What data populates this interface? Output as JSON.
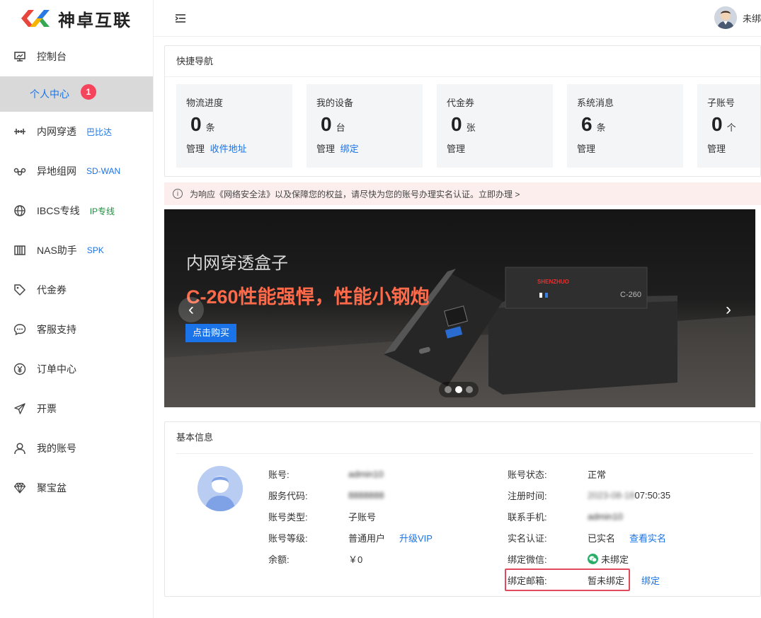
{
  "brand": {
    "name": "神卓互联"
  },
  "sidebar": {
    "items": [
      {
        "id": "console",
        "icon": "monitor-icon",
        "label": "控制台",
        "tag": ""
      },
      {
        "id": "personal",
        "icon": "",
        "label": "个人中心",
        "badge": "1"
      },
      {
        "id": "penetrate",
        "icon": "tunnel-icon",
        "label": "内网穿透",
        "tag": "巴比达"
      },
      {
        "id": "sdwan",
        "icon": "network-icon",
        "label": "异地组网",
        "tag": "SD-WAN"
      },
      {
        "id": "ibcs",
        "icon": "globe-icon",
        "label": "IBCS专线",
        "tag": "IP专线"
      },
      {
        "id": "nas",
        "icon": "nas-icon",
        "label": "NAS助手",
        "tag": "SPK"
      },
      {
        "id": "voucher",
        "icon": "tag-icon",
        "label": "代金券",
        "tag": ""
      },
      {
        "id": "support",
        "icon": "chat-icon",
        "label": "客服支持",
        "tag": ""
      },
      {
        "id": "orders",
        "icon": "yen-icon",
        "label": "订单中心",
        "tag": ""
      },
      {
        "id": "invoice",
        "icon": "send-icon",
        "label": "开票",
        "tag": ""
      },
      {
        "id": "account",
        "icon": "user-icon",
        "label": "我的账号",
        "tag": ""
      },
      {
        "id": "treasure",
        "icon": "diamond-icon",
        "label": "聚宝盆",
        "tag": ""
      }
    ]
  },
  "header": {
    "user_name": "未绑"
  },
  "quick_nav": {
    "title": "快捷导航",
    "cards": [
      {
        "title": "物流进度",
        "value": "0",
        "unit": "条",
        "action": "管理",
        "link": "收件地址"
      },
      {
        "title": "我的设备",
        "value": "0",
        "unit": "台",
        "action": "管理",
        "link": "绑定"
      },
      {
        "title": "代金券",
        "value": "0",
        "unit": "张",
        "action": "管理",
        "link": ""
      },
      {
        "title": "系统消息",
        "value": "6",
        "unit": "条",
        "action": "管理",
        "link": ""
      },
      {
        "title": "子账号",
        "value": "0",
        "unit": "个",
        "action": "管理",
        "link": ""
      }
    ]
  },
  "notice": {
    "text": "为响应《网络安全法》以及保障您的权益，请尽快为您的账号办理实名认证。立即办理 >"
  },
  "banner": {
    "subtitle": "内网穿透盒子",
    "title": "C-260性能强悍，性能小钢炮",
    "button": "点击购买",
    "device_brand": "SHENZHUO",
    "device_model": "C-260",
    "active_slide": 2,
    "slide_count": 3
  },
  "basic_info": {
    "title": "基本信息",
    "left": [
      {
        "key": "账号:",
        "value": "admin10",
        "blur": true,
        "link": ""
      },
      {
        "key": "服务代码:",
        "value": "8888888",
        "blur": true,
        "link": ""
      },
      {
        "key": "账号类型:",
        "value": "子账号",
        "blur": false,
        "link": ""
      },
      {
        "key": "账号等级:",
        "value": "普通用户",
        "blur": false,
        "link": "升级VIP"
      },
      {
        "key": "余额:",
        "value": "￥0",
        "blur": false,
        "link": ""
      }
    ],
    "right": [
      {
        "key": "账号状态:",
        "value": "正常",
        "link": ""
      },
      {
        "key": "注册时间:",
        "value_hidden": "2023-08-18 ",
        "value_visible": "07:50:35",
        "link": ""
      },
      {
        "key": "联系手机:",
        "value": "admin10",
        "link": ""
      },
      {
        "key": "实名认证:",
        "value": "已实名",
        "link": "查看实名"
      },
      {
        "key": "绑定微信:",
        "value": "未绑定",
        "link": ""
      },
      {
        "key": "绑定邮箱:",
        "value": "暂未绑定",
        "link": "绑定"
      }
    ]
  },
  "colors": {
    "accent": "#1a73e8",
    "badge": "#f5455c",
    "notice_bg": "#fdeeee",
    "highlight_border": "#e04a5c",
    "banner_title": "#ff6b4a"
  }
}
